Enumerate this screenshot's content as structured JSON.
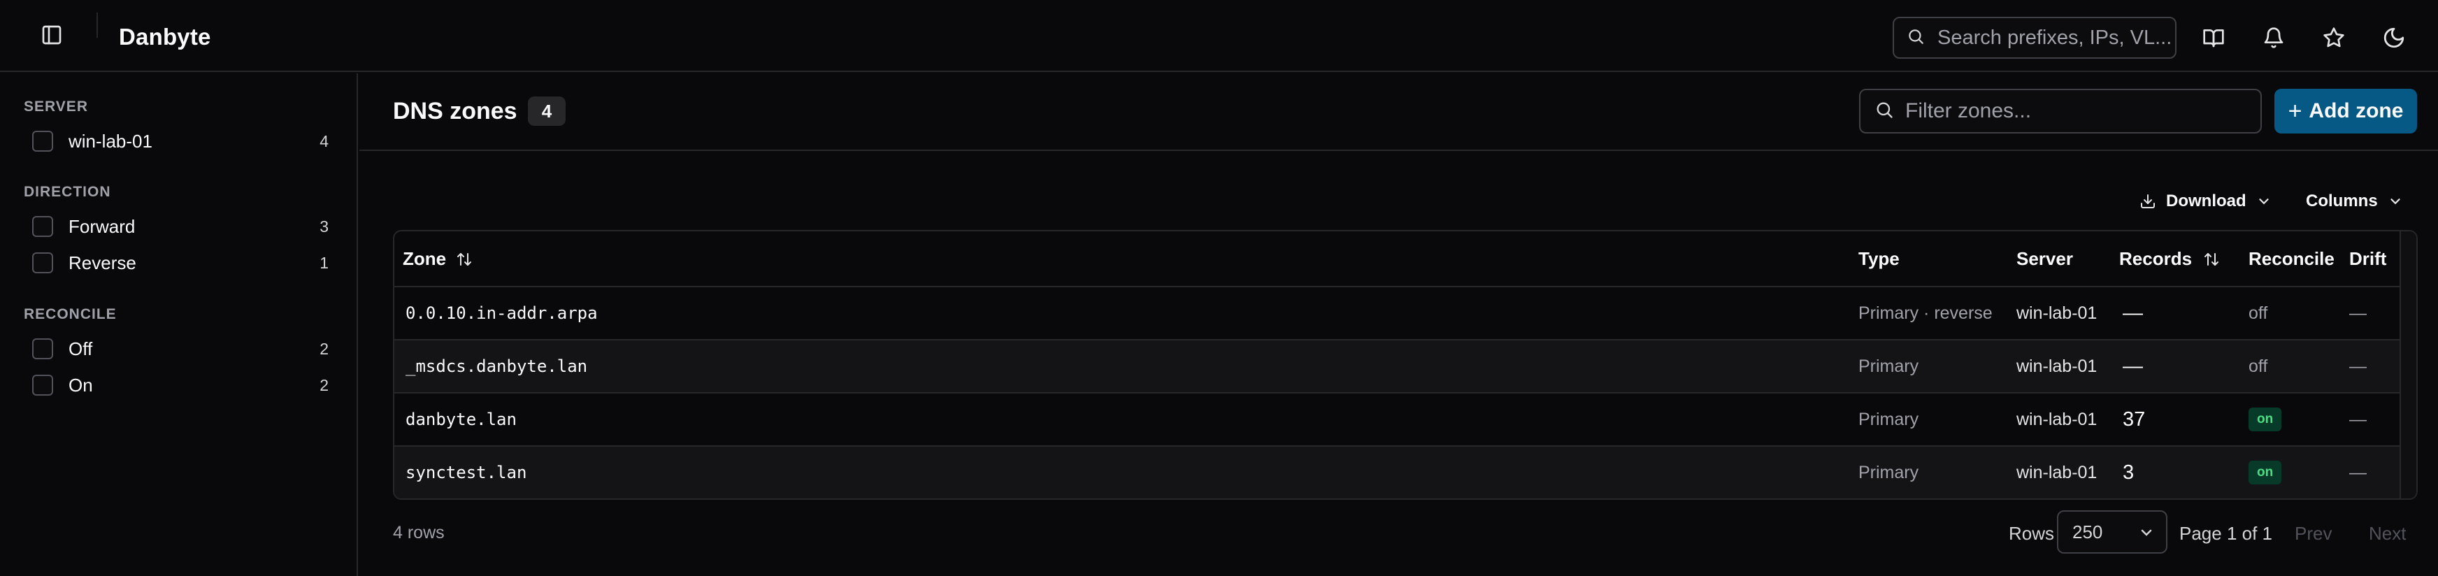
{
  "header": {
    "app_title": "Danbyte",
    "search_placeholder": "Search prefixes, IPs, VL...",
    "icons": [
      "sidebar-toggle-icon",
      "book-icon",
      "bell-icon",
      "star-icon",
      "moon-icon"
    ]
  },
  "sidebar": {
    "sections": [
      {
        "heading": "SERVER",
        "items": [
          {
            "label": "win-lab-01",
            "count": "4"
          }
        ]
      },
      {
        "heading": "DIRECTION",
        "items": [
          {
            "label": "Forward",
            "count": "3"
          },
          {
            "label": "Reverse",
            "count": "1"
          }
        ]
      },
      {
        "heading": "RECONCILE",
        "items": [
          {
            "label": "Off",
            "count": "2"
          },
          {
            "label": "On",
            "count": "2"
          }
        ]
      }
    ]
  },
  "main": {
    "title": "DNS zones",
    "count": "4",
    "filter_placeholder": "Filter zones...",
    "add_button": "Add zone",
    "download_label": "Download",
    "columns_label": "Columns"
  },
  "table": {
    "columns": [
      "Zone",
      "Type",
      "Server",
      "Records",
      "Reconcile",
      "Drift"
    ],
    "rows": [
      {
        "zone": "0.0.10.in-addr.arpa",
        "type": "Primary · reverse",
        "server": "win-lab-01",
        "records": "—",
        "reconcile": "off",
        "drift": "—"
      },
      {
        "zone": "_msdcs.danbyte.lan",
        "type": "Primary",
        "server": "win-lab-01",
        "records": "—",
        "reconcile": "off",
        "drift": "—"
      },
      {
        "zone": "danbyte.lan",
        "type": "Primary",
        "server": "win-lab-01",
        "records": "37",
        "reconcile": "on",
        "drift": "—"
      },
      {
        "zone": "synctest.lan",
        "type": "Primary",
        "server": "win-lab-01",
        "records": "3",
        "reconcile": "on",
        "drift": "—"
      }
    ]
  },
  "footer": {
    "row_count": "4 rows",
    "rows_label": "Rows",
    "rows_per_page": "250",
    "page_info": "Page 1 of 1",
    "prev": "Prev",
    "next": "Next"
  },
  "colors": {
    "background": "#09090b",
    "border": "#27272a",
    "accent": "#075985",
    "status_on": "#4ade80"
  }
}
